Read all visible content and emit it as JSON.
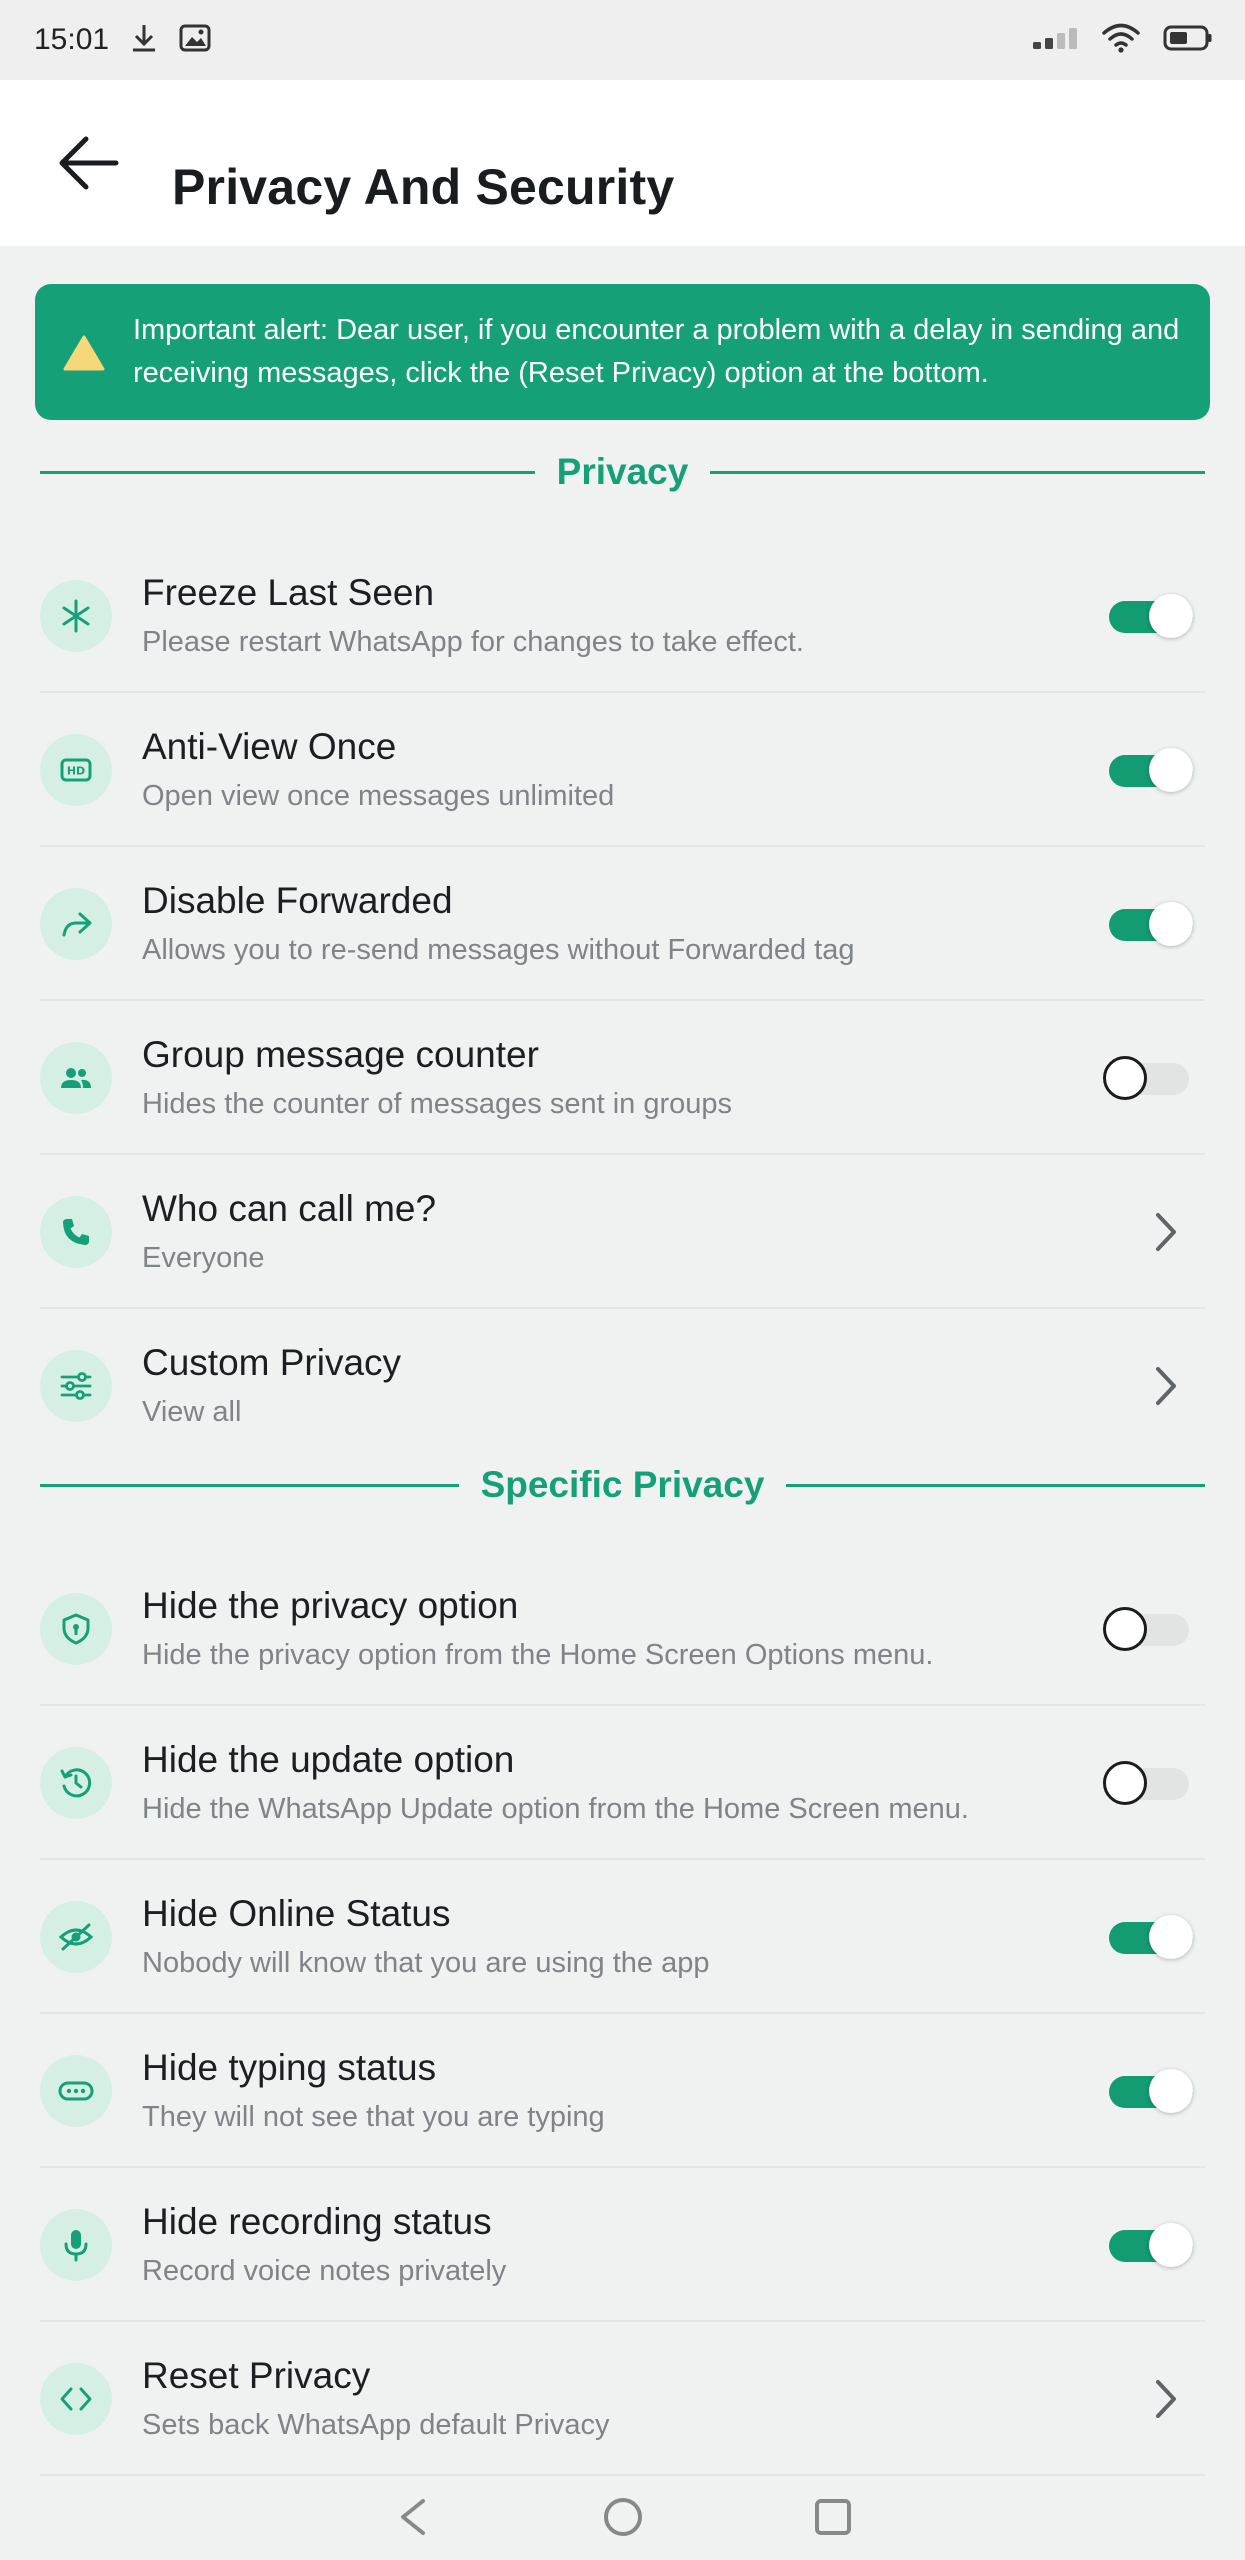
{
  "status_bar": {
    "time": "15:01",
    "icons": [
      "download-icon",
      "image-icon",
      "signal-icon",
      "wifi-icon",
      "battery-icon"
    ]
  },
  "app_bar": {
    "title": "Privacy And Security",
    "back_icon": "arrow-left-icon"
  },
  "alert": {
    "text": "Important alert: Dear user, if you encounter a problem with a delay in sending and receiving messages, click the (Reset Privacy) option at the bottom.",
    "icon": "warning-icon"
  },
  "sections": {
    "privacy": "Privacy",
    "specific_privacy": "Specific Privacy"
  },
  "privacy_items": [
    {
      "title": "Freeze Last Seen",
      "subtitle": "Please restart WhatsApp for changes to take effect.",
      "control": "toggle",
      "on": true,
      "icon": "snowflake-icon"
    },
    {
      "title": "Anti-View Once",
      "subtitle": "Open view once messages unlimited",
      "control": "toggle",
      "on": true,
      "icon": "hd-icon"
    },
    {
      "title": "Disable Forwarded",
      "subtitle": "Allows you to re-send messages without Forwarded tag",
      "control": "toggle",
      "on": true,
      "icon": "forward-icon"
    },
    {
      "title": "Group message counter",
      "subtitle": "Hides the counter of messages sent in groups",
      "control": "toggle",
      "on": false,
      "icon": "group-icon"
    },
    {
      "title": "Who can call me?",
      "subtitle": "Everyone",
      "control": "chevron",
      "icon": "phone-icon"
    },
    {
      "title": "Custom Privacy",
      "subtitle": "View all",
      "control": "chevron",
      "icon": "sliders-icon"
    }
  ],
  "specific_items": [
    {
      "title": "Hide the privacy option",
      "subtitle": "Hide the privacy option from the Home Screen Options menu.",
      "control": "toggle",
      "on": false,
      "icon": "shield-icon"
    },
    {
      "title": "Hide the update option",
      "subtitle": "Hide the WhatsApp Update option from the Home Screen menu.",
      "control": "toggle",
      "on": false,
      "icon": "history-icon"
    },
    {
      "title": "Hide Online Status",
      "subtitle": "Nobody will know that you are using the app",
      "control": "toggle",
      "on": true,
      "icon": "eye-off-icon"
    },
    {
      "title": "Hide typing status",
      "subtitle": "They will not see that you are typing",
      "control": "toggle",
      "on": true,
      "icon": "typing-icon"
    },
    {
      "title": "Hide recording status",
      "subtitle": "Record voice notes privately",
      "control": "toggle",
      "on": true,
      "icon": "microphone-icon"
    },
    {
      "title": "Reset Privacy",
      "subtitle": "Sets back WhatsApp default Privacy",
      "control": "chevron",
      "icon": "code-icon"
    }
  ],
  "colors": {
    "accent": "#16a077",
    "toggle_on": "#139b72",
    "icon_bg": "#d6efe5",
    "background": "#f0f2f2"
  }
}
